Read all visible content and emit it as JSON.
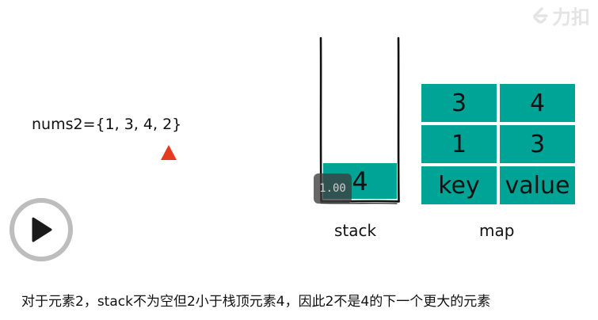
{
  "watermark": {
    "text": "力扣"
  },
  "array_label": "nums2={1, 3, 4, 2}",
  "stack": {
    "cells": [
      "4"
    ],
    "label": "stack"
  },
  "speed_badge": "1.00",
  "map": {
    "label": "map",
    "rows": [
      {
        "key": "3",
        "value": "4"
      },
      {
        "key": "1",
        "value": "3"
      }
    ],
    "header": {
      "key": "key",
      "value": "value"
    }
  },
  "subtitle": "对于元素2，stack不为空但2小于栈顶元素4，因此2不是4的下一个更大的元素",
  "colors": {
    "teal": "#00a497",
    "pointer": "#e53a1e",
    "play_ring": "#bdbdbd"
  },
  "icons": {
    "play": "play-icon",
    "pointer": "up-triangle-icon",
    "logo": "leetcode-logo-icon"
  }
}
